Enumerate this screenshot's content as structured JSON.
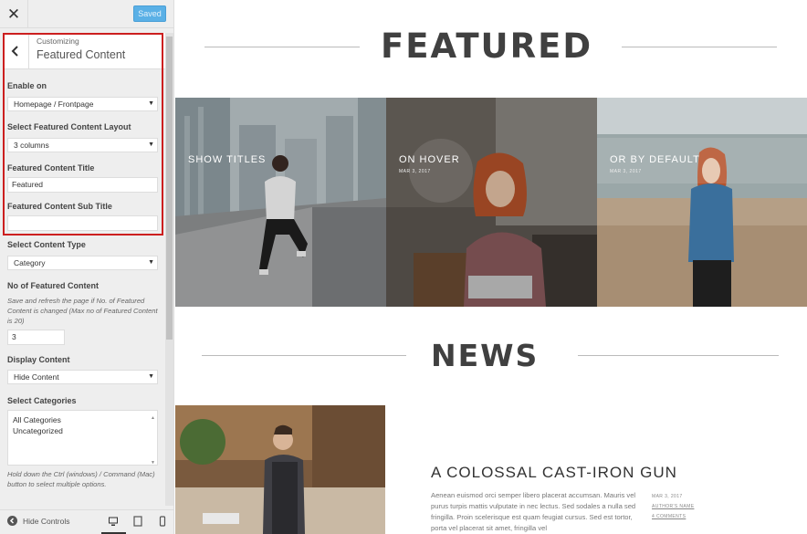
{
  "top_bar": {
    "close_symbol": "✕",
    "saved_label": "Saved"
  },
  "section": {
    "customizing": "Customizing",
    "title": "Featured Content"
  },
  "fields": {
    "enable_on": {
      "label": "Enable on",
      "value": "Homepage / Frontpage"
    },
    "layout": {
      "label": "Select Featured Content Layout",
      "value": "3 columns"
    },
    "featured_title": {
      "label": "Featured Content Title",
      "value": "Featured"
    },
    "featured_subtitle": {
      "label": "Featured Content Sub Title",
      "value": ""
    },
    "content_type": {
      "label": "Select Content Type",
      "value": "Category"
    },
    "count": {
      "label": "No of Featured Content",
      "description": "Save and refresh the page if No. of Featured Content is changed (Max no of Featured Content is 20)",
      "value": "3"
    },
    "display_content": {
      "label": "Display Content",
      "value": "Hide Content"
    },
    "categories": {
      "label": "Select Categories",
      "options": [
        "All Categories",
        "Uncategorized"
      ],
      "description": "Hold down the Ctrl (windows) / Command (Mac) button to select multiple options."
    }
  },
  "footer": {
    "hide_controls": "Hide Controls"
  },
  "preview": {
    "featured_heading": "FEATURED",
    "tiles": [
      {
        "title": "SHOW TITLES",
        "date": ""
      },
      {
        "title": "ON HOVER",
        "date": "MAR 3, 2017"
      },
      {
        "title": "OR BY DEFAULT",
        "date": "MAR 3, 2017"
      }
    ],
    "news_heading": "NEWS",
    "news_post": {
      "title": "A COLOSSAL CAST-IRON GUN",
      "body": "Aenean euismod orci semper libero placerat accumsan. Mauris vel purus turpis mattis vulputate in nec lectus. Sed sodales a nulla sed fringilla. Proin scelerisque est quam feugiat cursus. Sed est tortor, porta vel placerat sit amet, fringilla vel",
      "date": "MAR 3, 2017",
      "author": "AUTHOR'S NAME",
      "comments": "4 COMMENTS"
    }
  },
  "colors": {
    "accent": "#5ab0e6",
    "highlight": "#cc1f1f",
    "heading": "#404040"
  }
}
